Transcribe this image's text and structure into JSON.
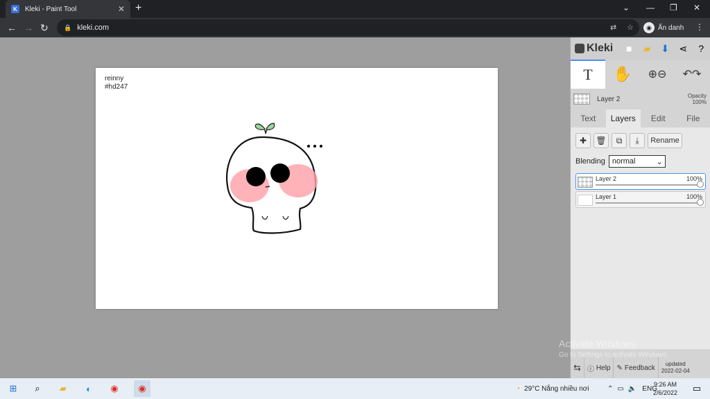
{
  "browser": {
    "tab_title": "Kleki - Paint Tool",
    "url": "kleki.com",
    "profile_label": "Ẩn danh"
  },
  "canvas": {
    "line1": "reinny",
    "line2": "#hd247"
  },
  "panel": {
    "logo": "Kleki",
    "current_layer": "Layer 2",
    "opacity_label": "Opacity",
    "opacity_value": "100%",
    "tabs": [
      "Text",
      "Layers",
      "Edit",
      "File"
    ],
    "active_tab": "Layers",
    "rename_label": "Rename",
    "blending_label": "Blending",
    "blending_value": "normal",
    "layers": [
      {
        "name": "Layer 2",
        "opacity": "100%"
      },
      {
        "name": "Layer 1",
        "opacity": "100%"
      }
    ],
    "footer": {
      "help": "Help",
      "feedback": "Feedback",
      "updated": "updated",
      "updated_date": "2022-02-04"
    }
  },
  "watermark": {
    "line1": "Activate Windows",
    "line2": "Go to Settings to activate Windows."
  },
  "taskbar": {
    "weather": "29°C  Nắng nhiều nơi",
    "lang": "ENG",
    "time": "9:26 AM",
    "date": "2/6/2022"
  }
}
